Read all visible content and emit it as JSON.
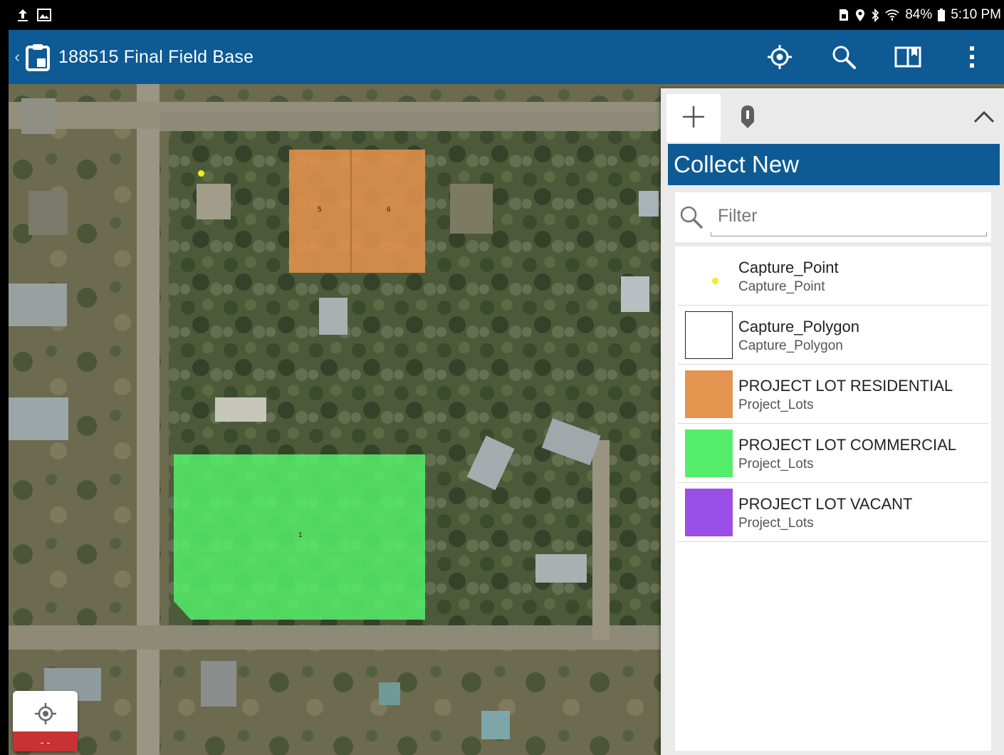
{
  "status_bar": {
    "battery": "84%",
    "time": "5:10 PM",
    "left_icons": [
      "upload-icon",
      "image-icon"
    ],
    "right_icons": [
      "sim-icon",
      "location-icon",
      "bluetooth-icon",
      "wifi-icon",
      "battery-icon"
    ]
  },
  "app_bar": {
    "title": "188515 Final Field Base",
    "actions": [
      "locate-icon",
      "search-icon",
      "bookmark-icon",
      "more-icon"
    ]
  },
  "map": {
    "lots": [
      {
        "label": "5",
        "color": "#e3914b"
      },
      {
        "label": "6",
        "color": "#e3914b"
      },
      {
        "label": "1",
        "color": "#55f06a"
      }
    ],
    "point_color": "#f2ec1c",
    "location_readout": "- -"
  },
  "panel": {
    "header": "Collect New",
    "filter_placeholder": "Filter",
    "tabs": [
      "plus-icon",
      "map-pin-icon"
    ],
    "items": [
      {
        "name": "Capture_Point",
        "layer": "Capture_Point",
        "swatch": "point"
      },
      {
        "name": "Capture_Polygon",
        "layer": "Capture_Polygon",
        "swatch": "#ffffff"
      },
      {
        "name": "PROJECT LOT RESIDENTIAL",
        "layer": "Project_Lots",
        "swatch": "#e3944e"
      },
      {
        "name": "PROJECT LOT COMMERCIAL",
        "layer": "Project_Lots",
        "swatch": "#55ee6b"
      },
      {
        "name": "PROJECT LOT VACANT",
        "layer": "Project_Lots",
        "swatch": "#9a4fe6"
      }
    ]
  },
  "colors": {
    "accent": "#0d5a94",
    "gps_indicator": "#c73232"
  }
}
